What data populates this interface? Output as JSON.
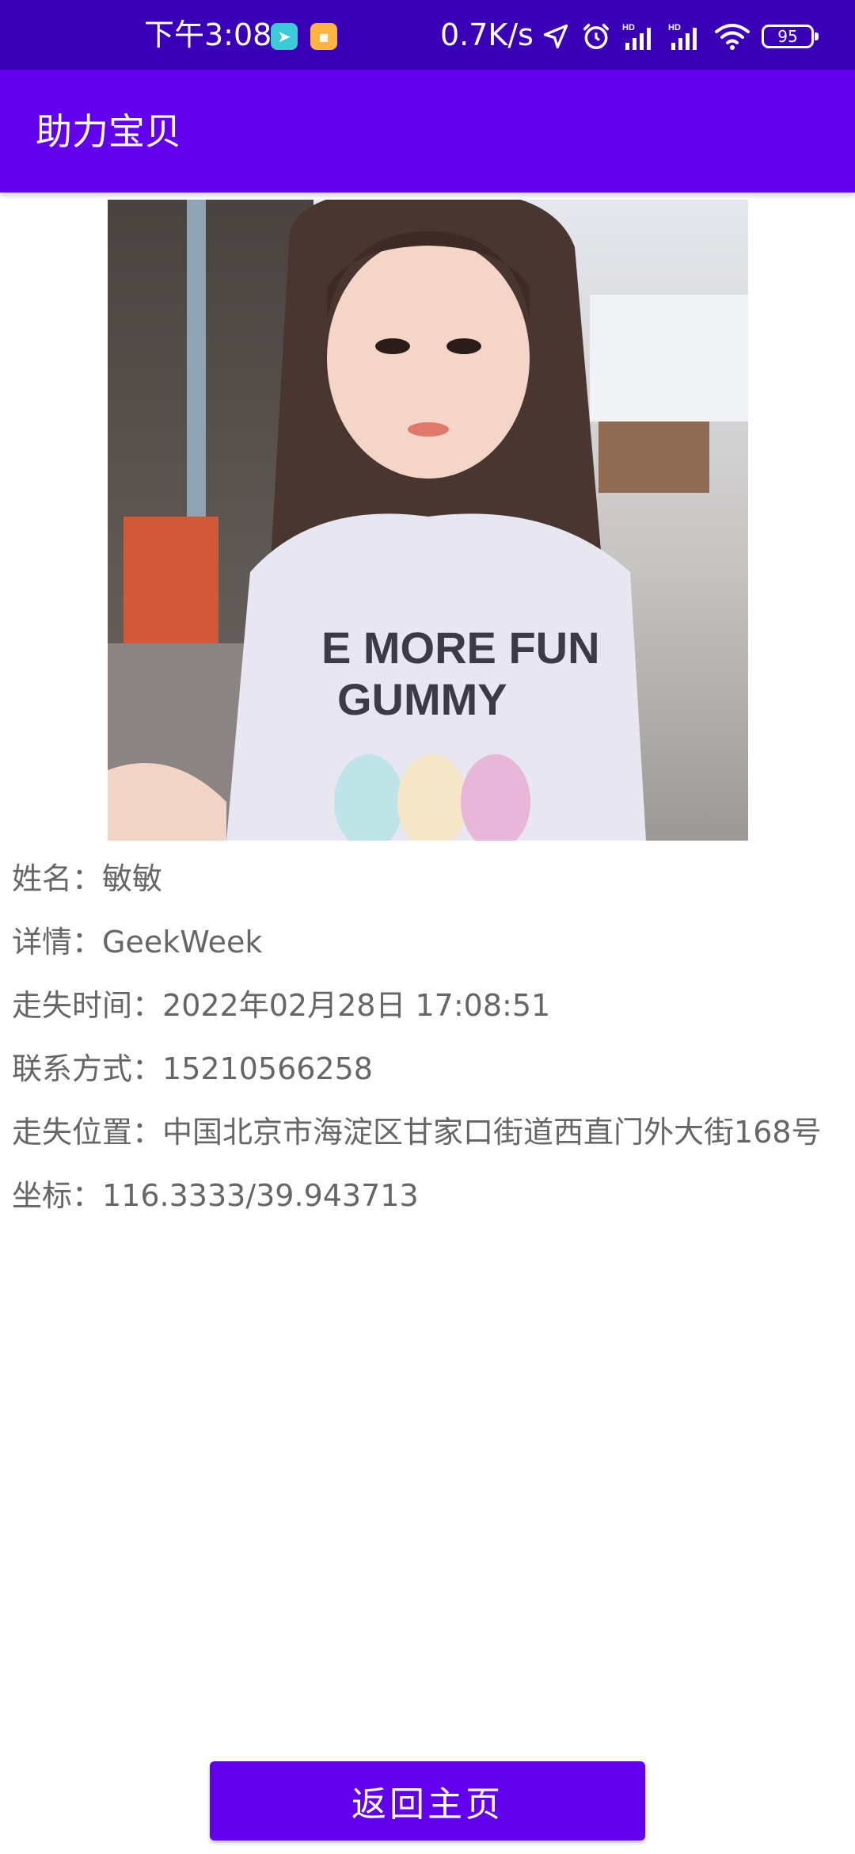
{
  "status_bar": {
    "time": "下午3:08",
    "net_speed": "0.7K/s",
    "battery": "95",
    "icons": [
      "telegram-icon",
      "message-icon",
      "location-icon",
      "alarm-icon",
      "signal-hd-icon",
      "signal-hd-icon",
      "wifi-icon",
      "battery-icon"
    ]
  },
  "app_bar": {
    "title": "助力宝贝"
  },
  "photo": {
    "alt": "child-photo"
  },
  "details": {
    "name_label": "姓名：",
    "name": "敏敏",
    "detail_label": "详情：",
    "detail": "GeekWeek",
    "lost_time_label": "走失时间：",
    "lost_time": "2022年02月28日 17:08:51",
    "contact_label": "联系方式：",
    "contact": "15210566258",
    "location_label": "走失位置：",
    "location": "中国北京市海淀区甘家口街道西直门外大街168号",
    "coords_label": "坐标：",
    "coords": "116.3333/39.943713"
  },
  "actions": {
    "back_label": "返回主页"
  },
  "colors": {
    "status_bar": "#3a00b8",
    "primary": "#6200ee",
    "text": "#666666"
  }
}
